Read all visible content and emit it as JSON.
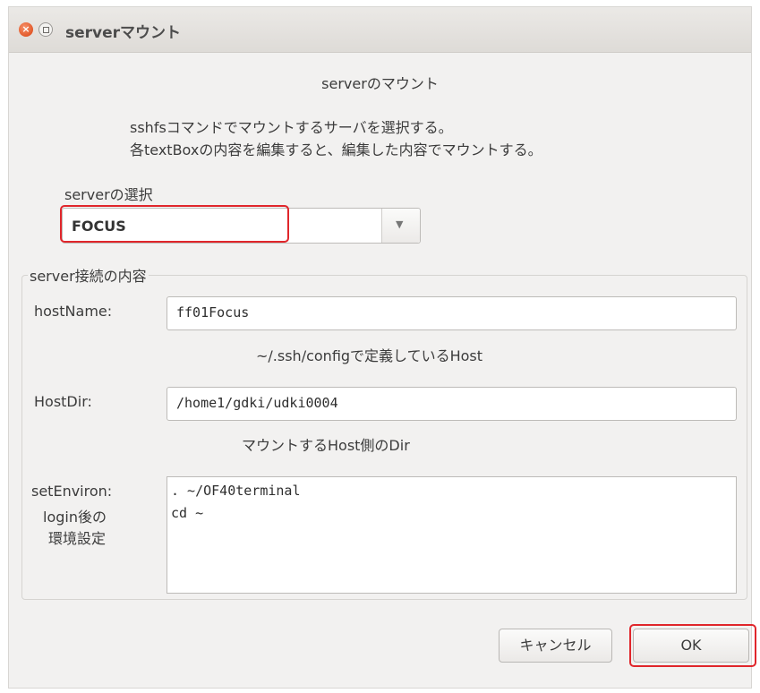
{
  "window": {
    "title": "serverマウント"
  },
  "dialog": {
    "heading": "serverのマウント",
    "description": [
      "sshfsコマンドでマウントするサーバを選択する。",
      "各textBoxの内容を編集すると、編集した内容でマウントする。"
    ],
    "server_select": {
      "label": "serverの選択",
      "value": "FOCUS",
      "dropdown_icon": "triangle-down-icon"
    },
    "connection": {
      "group_label": "server接続の内容",
      "hostname": {
        "label": "hostName:",
        "value": "ff01Focus",
        "hint": "~/.ssh/configで定義しているHost"
      },
      "hostdir": {
        "label": "HostDir:",
        "value": "/home1/gdki/udki0004",
        "hint": "マウントするHost側のDir"
      },
      "setenviron": {
        "label_lines": [
          "setEnviron:",
          "login後の",
          "環境設定"
        ],
        "lines": [
          ". ~/OF40terminal",
          "cd ~"
        ]
      }
    },
    "buttons": {
      "cancel": "キャンセル",
      "ok": "OK"
    }
  },
  "annotation_color": "#e0262b"
}
